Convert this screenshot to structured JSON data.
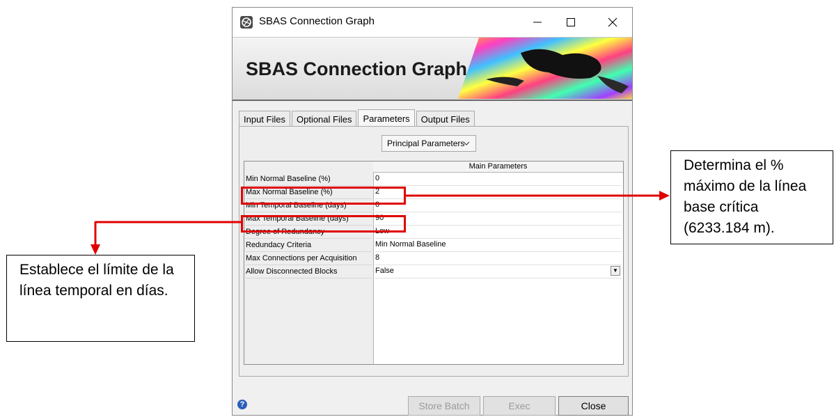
{
  "window": {
    "title": "SBAS Connection Graph",
    "icon": "app-logo-icon",
    "controls": [
      "minimize-icon",
      "maximize-icon",
      "close-icon"
    ]
  },
  "banner": {
    "title": "SBAS Connection Graph"
  },
  "tabs": [
    {
      "label": "Input Files",
      "active": false
    },
    {
      "label": "Optional Files",
      "active": false
    },
    {
      "label": "Parameters",
      "active": true
    },
    {
      "label": "Output Files",
      "active": false
    }
  ],
  "dropdown": {
    "value": "Principal Parameters"
  },
  "table": {
    "header": "Main Parameters",
    "rows": [
      {
        "label": "Min Normal Baseline (%)",
        "value": "0"
      },
      {
        "label": "Max Normal Baseline (%)",
        "value": "2"
      },
      {
        "label": "Min Temporal Baseline (days)",
        "value": "0"
      },
      {
        "label": "Max Temporal Baseline (days)",
        "value": "90"
      },
      {
        "label": "Degree of Redundancy",
        "value": "Low"
      },
      {
        "label": "Redundacy Criteria",
        "value": "Min Normal Baseline"
      },
      {
        "label": "Max Connections per Acquisition",
        "value": "8"
      },
      {
        "label": "Allow Disconnected Blocks",
        "value": "False"
      }
    ]
  },
  "buttons": {
    "store_batch": "Store Batch",
    "exec": "Exec",
    "close": "Close"
  },
  "annotations": {
    "right_callout": "Determina el % máximo de la línea base crítica (6233.184 m).",
    "left_callout": "Establece el límite de la línea temporal en días.",
    "color": "#e00000"
  }
}
